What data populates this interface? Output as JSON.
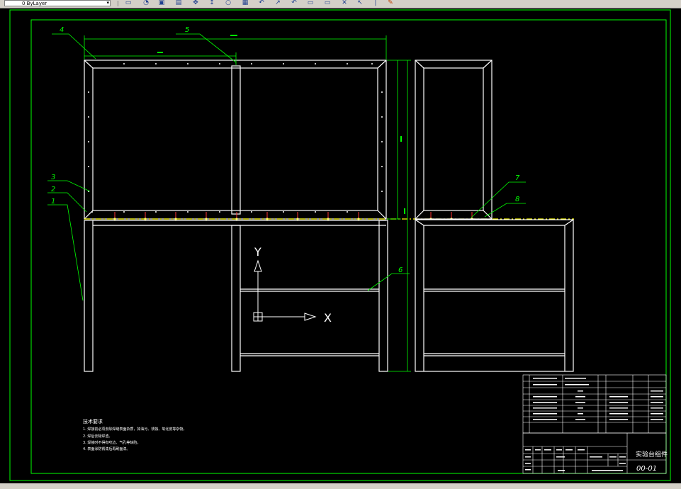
{
  "toolbar": {
    "layer_combo_value": "0 ByLayer",
    "icons": [
      "new-icon",
      "open-icon",
      "save-icon",
      "print-icon",
      "pan-icon",
      "zoom-icon",
      "properties-icon",
      "match-icon",
      "undo-icon",
      "redo-icon",
      "rectangle-icon",
      "line-icon",
      "erase-icon",
      "help-icon"
    ]
  },
  "drawing": {
    "part_labels": [
      "1",
      "2",
      "3",
      "4",
      "5",
      "6",
      "7",
      "8"
    ],
    "axis_labels": {
      "x": "X",
      "y": "Y"
    },
    "tech_requirements": {
      "title": "技术要求",
      "lines": [
        "1. 焊接前必须去除焊缝表面杂质，如油污、锈蚀、氧化皮等杂物。",
        "2. 焊后去除焊渣。",
        "3. 焊接时不得有咬边、气孔等缺陷。",
        "4. 表面涂防锈漆后再刷面漆。"
      ]
    },
    "title_block": {
      "title": "实验台组件",
      "drawing_no": "00-01"
    }
  },
  "colors": {
    "background": "#000000",
    "frame": "#00ff00",
    "geometry": "#ffffff",
    "dimension": "#00ff00",
    "center_line": "#ffff00",
    "marker": "#ff0000"
  }
}
